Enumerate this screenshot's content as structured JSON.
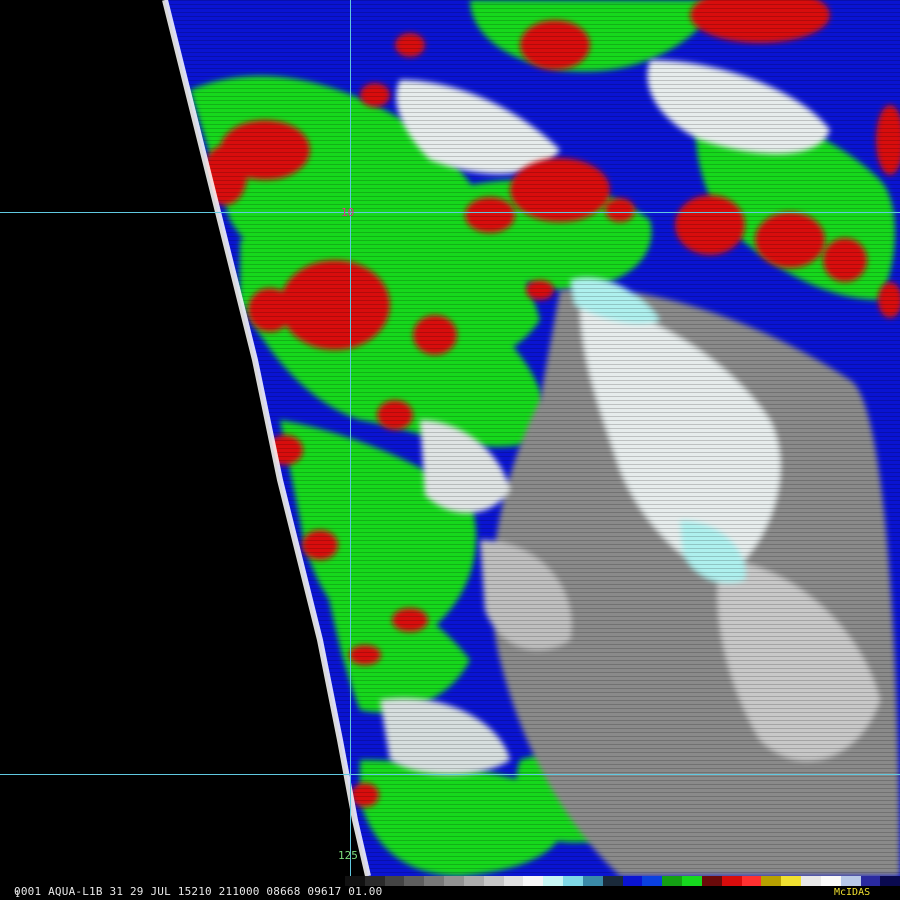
{
  "image": {
    "satellite": "AQUA-L1B",
    "footer_text": "0001 AQUA-L1B  31 29 JUL 15210 211000 08668 09617 01.00",
    "footer_mark": "1",
    "brand": "McIDAS",
    "lat_label": "10",
    "lon_label": "125"
  },
  "colors": {
    "red": "#d80c0c",
    "green": "#16d81e",
    "blue": "#0a14d2",
    "white": "#e6ecec",
    "grey": "#8a8a8a",
    "cyan": "#aef0ee",
    "grid": "#60c8e0",
    "no_data": "#000000"
  },
  "colorbar": [
    "#111111",
    "#2a2a2a",
    "#444444",
    "#5e5e5e",
    "#787878",
    "#929292",
    "#acacac",
    "#c6c6c6",
    "#e0e0e0",
    "#f6f6f6",
    "#c8f6f4",
    "#7fd8e6",
    "#3a8aa8",
    "#1a2a3a",
    "#0a14d2",
    "#0a40e0",
    "#14a014",
    "#16d81e",
    "#6a0a0a",
    "#d80c0c",
    "#ff3030",
    "#b8a000",
    "#f0e030",
    "#e8e8e8",
    "#fafafa",
    "#b8c8e8",
    "#2a2aa0",
    "#0a0a50"
  ]
}
